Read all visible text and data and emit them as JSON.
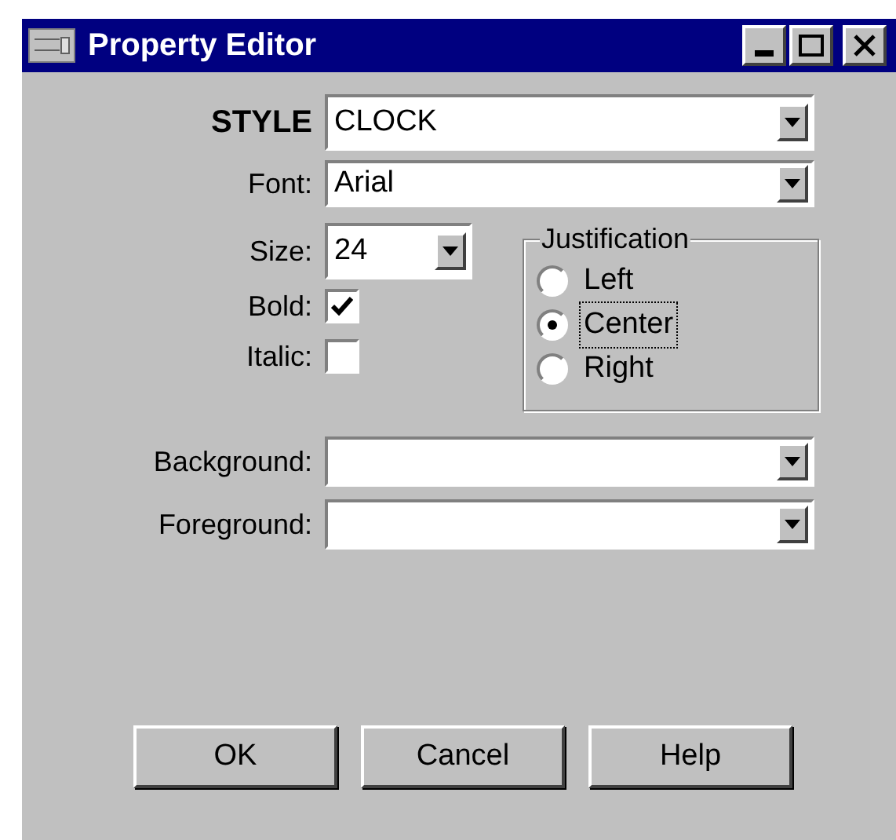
{
  "window": {
    "title": "Property Editor"
  },
  "style": {
    "label": "STYLE",
    "value": "CLOCK"
  },
  "font": {
    "label": "Font:",
    "value": "Arial"
  },
  "size": {
    "label": "Size:",
    "value": "24"
  },
  "checks": [
    {
      "label": "Bold:",
      "checked": true
    },
    {
      "label": "Italic:",
      "checked": false
    }
  ],
  "justification": {
    "title": "Justification",
    "options": [
      {
        "label": "Left",
        "selected": false
      },
      {
        "label": "Center",
        "selected": true
      },
      {
        "label": "Right",
        "selected": false
      }
    ]
  },
  "colors": [
    {
      "label": "Background:"
    },
    {
      "label": "Foreground:"
    }
  ],
  "buttons": [
    "OK",
    "Cancel",
    "Help"
  ]
}
